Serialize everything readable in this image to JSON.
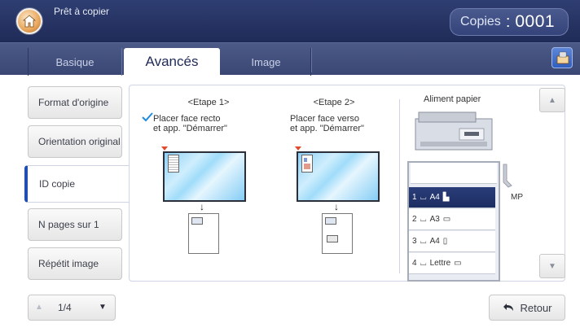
{
  "status": {
    "text": "Prêt à copier"
  },
  "copies": {
    "label": "Copies",
    "separator": ":",
    "value": "0001"
  },
  "tabs": [
    {
      "label": "Basique"
    },
    {
      "label": "Avancés"
    },
    {
      "label": "Image"
    }
  ],
  "sidebar": {
    "items": [
      {
        "label": "Format d'origine"
      },
      {
        "label": "Orientation original"
      },
      {
        "label": "ID copie"
      },
      {
        "label": "N pages sur 1"
      },
      {
        "label": "Répétit image"
      }
    ]
  },
  "step1": {
    "title": "<Etape 1>",
    "desc_line1": "Placer face recto",
    "desc_line2": "et app. \"Démarrer\""
  },
  "step2": {
    "title": "<Etape 2>",
    "desc_line1": "Placer face verso",
    "desc_line2": "et app. \"Démarrer\""
  },
  "aliment": {
    "title": "Aliment papier",
    "mp": "MP"
  },
  "trays": [
    {
      "num": "1",
      "size": "A4"
    },
    {
      "num": "2",
      "size": "A3"
    },
    {
      "num": "3",
      "size": "A4"
    },
    {
      "num": "4",
      "size": "Lettre"
    }
  ],
  "pager": {
    "text": "1/4"
  },
  "retour": {
    "label": "Retour"
  },
  "colors": {
    "topbar": "#1f2b57",
    "selected_tray": "#1c2d60",
    "checkmark": "#1e8be0"
  },
  "icons": {
    "home": "home-icon",
    "save": "save-icon",
    "retour": "back-arrow-icon"
  }
}
